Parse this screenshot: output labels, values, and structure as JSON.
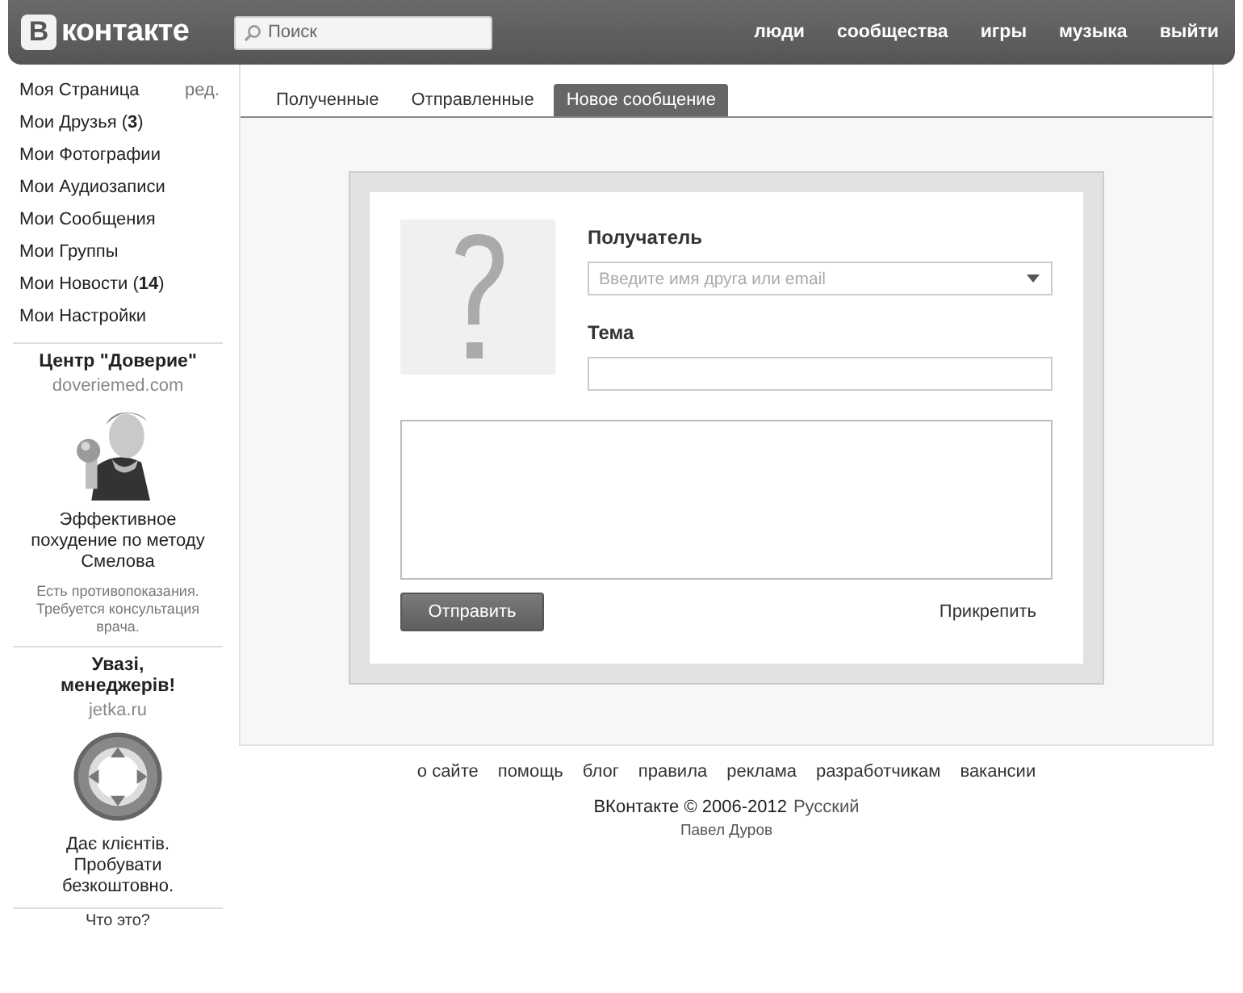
{
  "header": {
    "logo_letter": "В",
    "logo_text": "контакте",
    "search": {
      "placeholder": "Поиск"
    },
    "nav": [
      "люди",
      "сообщества",
      "игры",
      "музыка",
      "выйти"
    ]
  },
  "sidebar": {
    "items": [
      {
        "label": "Моя Страница",
        "extra": "ред."
      },
      {
        "label": "Мои Друзья (**3**)"
      },
      {
        "label": "Мои Фотографии"
      },
      {
        "label": "Мои Аудиозаписи"
      },
      {
        "label": "Мои Сообщения"
      },
      {
        "label": "Мои Группы"
      },
      {
        "label": "Мои Новости (**14**)"
      },
      {
        "label": "Мои Настройки"
      }
    ],
    "ads": [
      {
        "title": "Центр \"Доверие\"",
        "domain": "doveriemed.com",
        "text": "Эффективное похудение по методу Смелова",
        "note": "Есть противопоказания. Требуется консультация врача."
      },
      {
        "title": "Увазі, менеджерів!",
        "domain": "jetka.ru",
        "text": "Дає клієнтів. Пробувати безкоштовно."
      }
    ],
    "footer_link": "Что это?"
  },
  "tabs": [
    {
      "label": "Полученные",
      "selected": false
    },
    {
      "label": "Отправленные",
      "selected": false
    },
    {
      "label": "Новое сообщение",
      "selected": true
    }
  ],
  "compose": {
    "recipient_label": "Получатель",
    "recipient_placeholder": "Введите имя друга или email",
    "subject_label": "Тема",
    "send_button": "Отправить",
    "attach_link": "Прикрепить"
  },
  "footer": {
    "links": [
      "о сайте",
      "помощь",
      "блог",
      "правила",
      "реклама",
      "разработчикам",
      "вакансии"
    ],
    "copyright": "ВКонтакте © 2006-2012",
    "language": "Русский",
    "author": "Павел Дуров"
  }
}
